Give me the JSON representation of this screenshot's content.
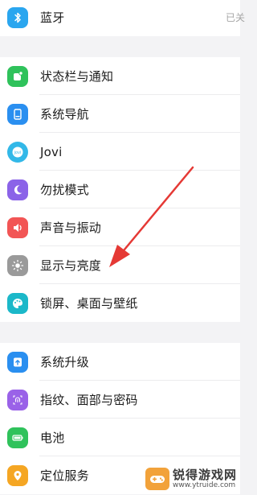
{
  "settings": {
    "bluetooth": {
      "label": "蓝牙",
      "value": "已关",
      "icon": "bluetooth-icon",
      "color": "#2aa6ef"
    },
    "group1": [
      {
        "key": "statusbar",
        "label": "状态栏与通知",
        "icon": "notification-icon",
        "color": "#2fc25b"
      },
      {
        "key": "navigation",
        "label": "系统导航",
        "icon": "navigation-icon",
        "color": "#2a8ff0"
      },
      {
        "key": "jovi",
        "label": "Jovi",
        "icon": "jovi-icon",
        "color": "#32b8e8"
      },
      {
        "key": "dnd",
        "label": "勿扰模式",
        "icon": "moon-icon",
        "color": "#8b63e8"
      },
      {
        "key": "sound",
        "label": "声音与振动",
        "icon": "speaker-icon",
        "color": "#f25555"
      },
      {
        "key": "display",
        "label": "显示与亮度",
        "icon": "brightness-icon",
        "color": "#9a9a9a"
      },
      {
        "key": "wallpaper",
        "label": "锁屏、桌面与壁纸",
        "icon": "palette-icon",
        "color": "#1bb8c9"
      }
    ],
    "group2": [
      {
        "key": "upgrade",
        "label": "系统升级",
        "icon": "upgrade-icon",
        "color": "#2a8ff0"
      },
      {
        "key": "biometrics",
        "label": "指纹、面部与密码",
        "icon": "fingerprint-icon",
        "color": "#9a62e8"
      },
      {
        "key": "battery",
        "label": "电池",
        "icon": "battery-icon",
        "color": "#2fc25b"
      },
      {
        "key": "location",
        "label": "定位服务",
        "icon": "location-icon",
        "color": "#f5a623"
      }
    ]
  },
  "annotation": {
    "arrow_color": "#e53935"
  },
  "watermark": {
    "name": "锐得游戏网",
    "url": "www.ytruide.com",
    "color": "#f2a23a"
  }
}
